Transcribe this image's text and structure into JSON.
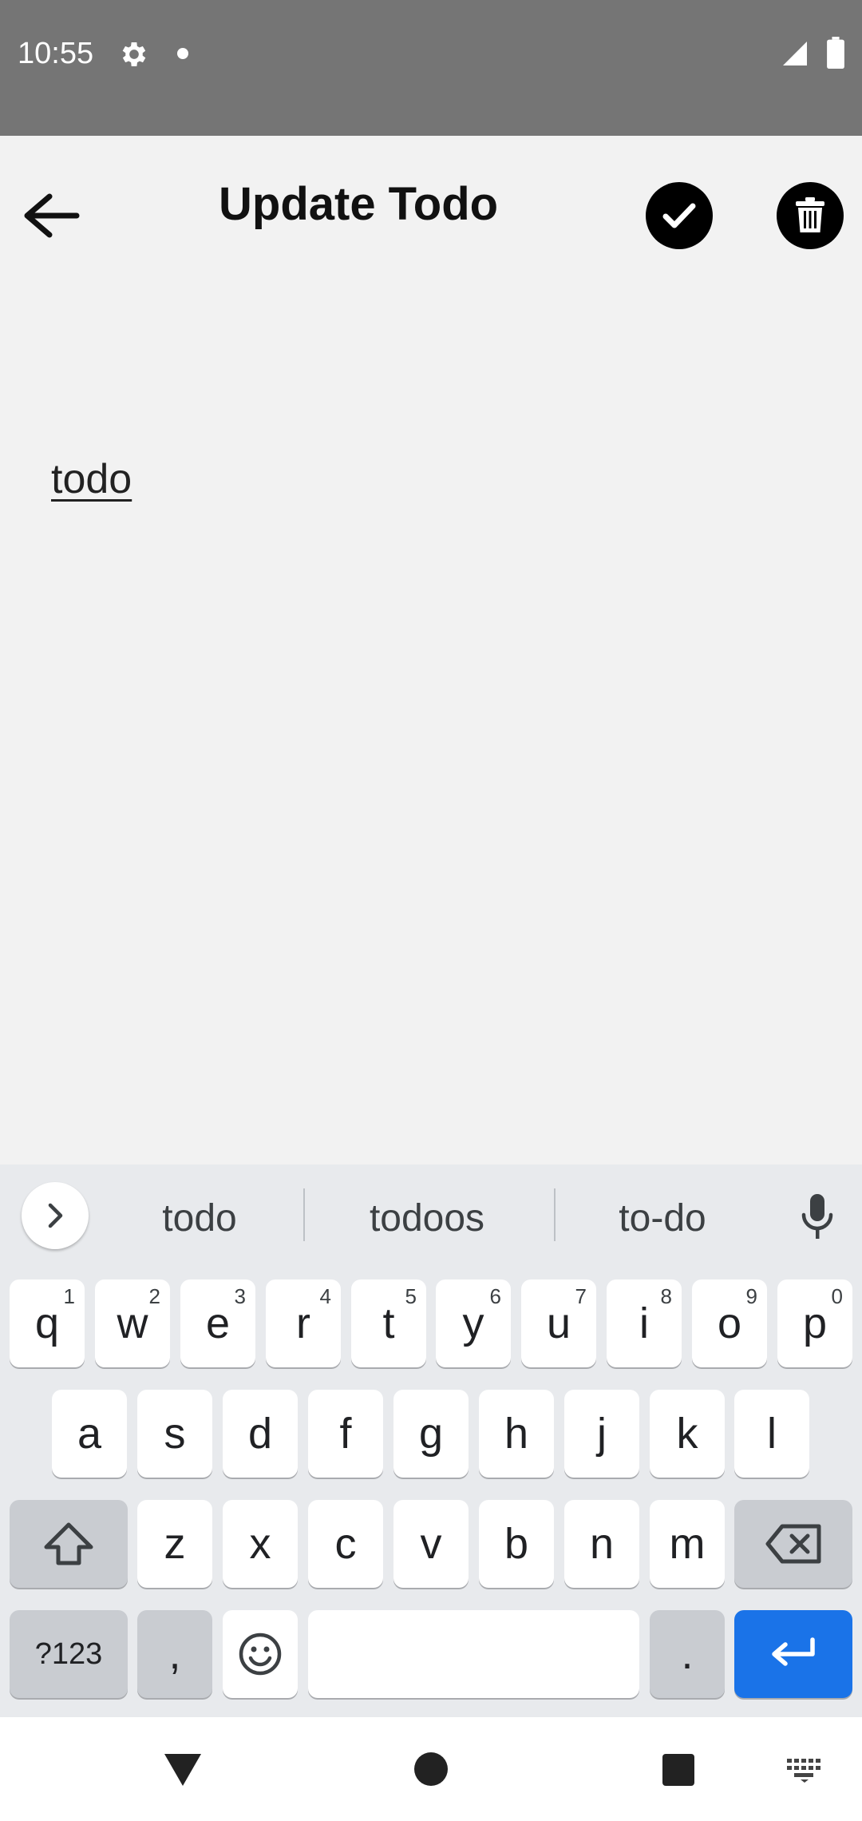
{
  "status_bar": {
    "time": "10:55"
  },
  "app_bar": {
    "title": "Update Todo"
  },
  "editor": {
    "todo_text": "todo"
  },
  "keyboard": {
    "suggestions": [
      "todo",
      "todoos",
      "to-do"
    ],
    "row1": [
      {
        "label": "q",
        "sup": "1"
      },
      {
        "label": "w",
        "sup": "2"
      },
      {
        "label": "e",
        "sup": "3"
      },
      {
        "label": "r",
        "sup": "4"
      },
      {
        "label": "t",
        "sup": "5"
      },
      {
        "label": "y",
        "sup": "6"
      },
      {
        "label": "u",
        "sup": "7"
      },
      {
        "label": "i",
        "sup": "8"
      },
      {
        "label": "o",
        "sup": "9"
      },
      {
        "label": "p",
        "sup": "0"
      }
    ],
    "row2": [
      "a",
      "s",
      "d",
      "f",
      "g",
      "h",
      "j",
      "k",
      "l"
    ],
    "row3": [
      "z",
      "x",
      "c",
      "v",
      "b",
      "n",
      "m"
    ],
    "symbols_label": "?123",
    "comma_label": ",",
    "period_label": "."
  },
  "colors": {
    "enter_key": "#1a73e8",
    "status_bar": "#757575",
    "background": "#f2f2f2"
  }
}
